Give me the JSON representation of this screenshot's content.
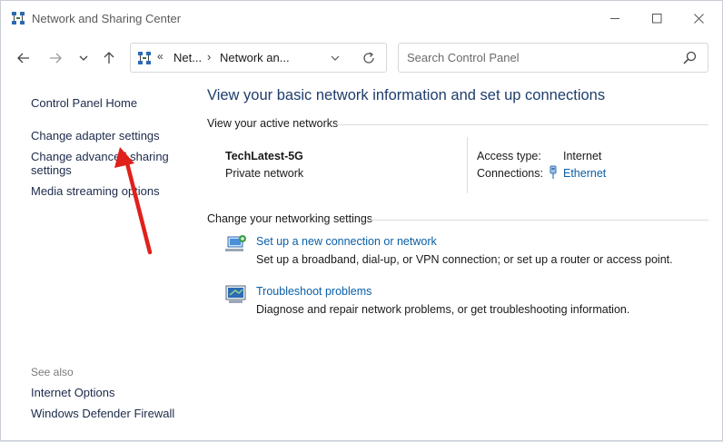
{
  "window": {
    "title": "Network and Sharing Center"
  },
  "address": {
    "chevron": "«",
    "crumbs": [
      "Net...",
      "Network an..."
    ],
    "sep": "›"
  },
  "search": {
    "placeholder": "Search Control Panel"
  },
  "left_pane": {
    "home": "Control Panel Home",
    "items": [
      "Change adapter settings",
      "Change advanced sharing settings",
      "Media streaming options"
    ],
    "see_also_label": "See also",
    "see_also": [
      "Internet Options",
      "Windows Defender Firewall"
    ]
  },
  "main": {
    "title": "View your basic network information and set up connections",
    "active_label": "View your active networks",
    "network": {
      "name": "TechLatest-5G",
      "type": "Private network",
      "access_type_label": "Access type:",
      "access_type_value": "Internet",
      "connections_label": "Connections:",
      "connections_value": "Ethernet"
    },
    "settings_label": "Change your networking settings",
    "tasks": [
      {
        "title": "Set up a new connection or network",
        "desc": "Set up a broadband, dial-up, or VPN connection; or set up a router or access point."
      },
      {
        "title": "Troubleshoot problems",
        "desc": "Diagnose and repair network problems, or get troubleshooting information."
      }
    ]
  },
  "colors": {
    "link": "#0a5fa8",
    "title": "#1e3d6b",
    "annotation_arrow": "#e0201b"
  }
}
